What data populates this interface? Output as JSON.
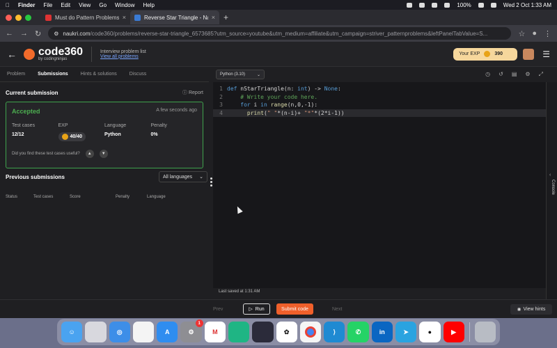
{
  "menubar": {
    "apple": "",
    "items": [
      "Finder",
      "File",
      "Edit",
      "View",
      "Go",
      "Window",
      "Help"
    ],
    "battery": "100%",
    "datetime": "Wed 2 Oct  1:33 AM"
  },
  "browser": {
    "tabs": [
      {
        "title": "Must do Pattern Problems be",
        "close": "×"
      },
      {
        "title": "Reverse Star Triangle - Nauk",
        "close": "×"
      }
    ],
    "new_tab": "+",
    "url_host": "naukri.com",
    "url_path": "/code360/problems/reverse-star-triangle_6573685?utm_source=youtube&utm_medium=affiliate&utm_campaign=striver_patternproblems&leftPanelTabValue=S..."
  },
  "header": {
    "back": "←",
    "logo_main_a": "code",
    "logo_main_b": "360",
    "logo_sub": "by codingninjas",
    "crumb_title": "Interview problem list",
    "crumb_link": "View all problems",
    "exp_label": "Your EXP",
    "exp_value": "390",
    "menu": "☰"
  },
  "left": {
    "tabs": [
      "Problem",
      "Submissions",
      "Hints & solutions",
      "Discuss"
    ],
    "current_title": "Current submission",
    "report": "Report",
    "status": "Accepted",
    "ago": "A few seconds ago",
    "stats": [
      {
        "label": "Test cases",
        "value": "12/12"
      },
      {
        "label": "EXP",
        "value": "40/40"
      },
      {
        "label": "Language",
        "value": "Python"
      },
      {
        "label": "Penalty",
        "value": "0%"
      }
    ],
    "useful_q": "Did you find these test cases useful?",
    "prev_title": "Previous submissions",
    "lang_filter": "All languages",
    "columns": [
      "Status",
      "Test cases",
      "Score",
      "Penalty",
      "Language"
    ]
  },
  "editor": {
    "language": "Python (3.10)",
    "line_numbers": [
      "1",
      "2",
      "3",
      "4"
    ],
    "saved": "Last saved at 1:31 AM",
    "console": "Console"
  },
  "bottom": {
    "prev": "Prev",
    "run": "Run",
    "submit": "Submit code",
    "next": "Next",
    "hints": "View hints"
  },
  "colors": {
    "accent": "#f0602b",
    "accepted": "#4caf50",
    "link": "#7aa6ff"
  },
  "dock": [
    "Finder",
    "Launchpad",
    "Safari",
    "Photos",
    "App Store",
    "System Settings",
    "Gmail",
    "Cloud",
    "DaVinci",
    "ChatGPT",
    "Chrome",
    "VS Code",
    "WhatsApp",
    "LinkedIn",
    "Telegram",
    "GitHub",
    "YouTube",
    "Trash"
  ],
  "dock_badge": "1"
}
